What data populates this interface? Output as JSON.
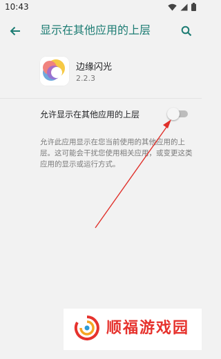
{
  "status_bar": {
    "time": "10:43"
  },
  "toolbar": {
    "title": "显示在其他应用的上层"
  },
  "app": {
    "name": "边缘闪光",
    "version": "2.2.3"
  },
  "overlay_setting": {
    "label": "允许显示在其他应用的上层",
    "enabled": false,
    "description": "允许此应用显示在您当前使用的其他应用的上层。这可能会干扰您使用相关应用，或变更这类应用的显示或运行方式。"
  },
  "colors": {
    "accent": "#1c7c73",
    "arrow": "#e0302a",
    "watermark": "#e6322d"
  },
  "icons": [
    "back-arrow-icon",
    "search-icon",
    "wifi-icon",
    "signal-icon",
    "battery-icon"
  ],
  "watermark": {
    "text": "顺福游戏园"
  }
}
